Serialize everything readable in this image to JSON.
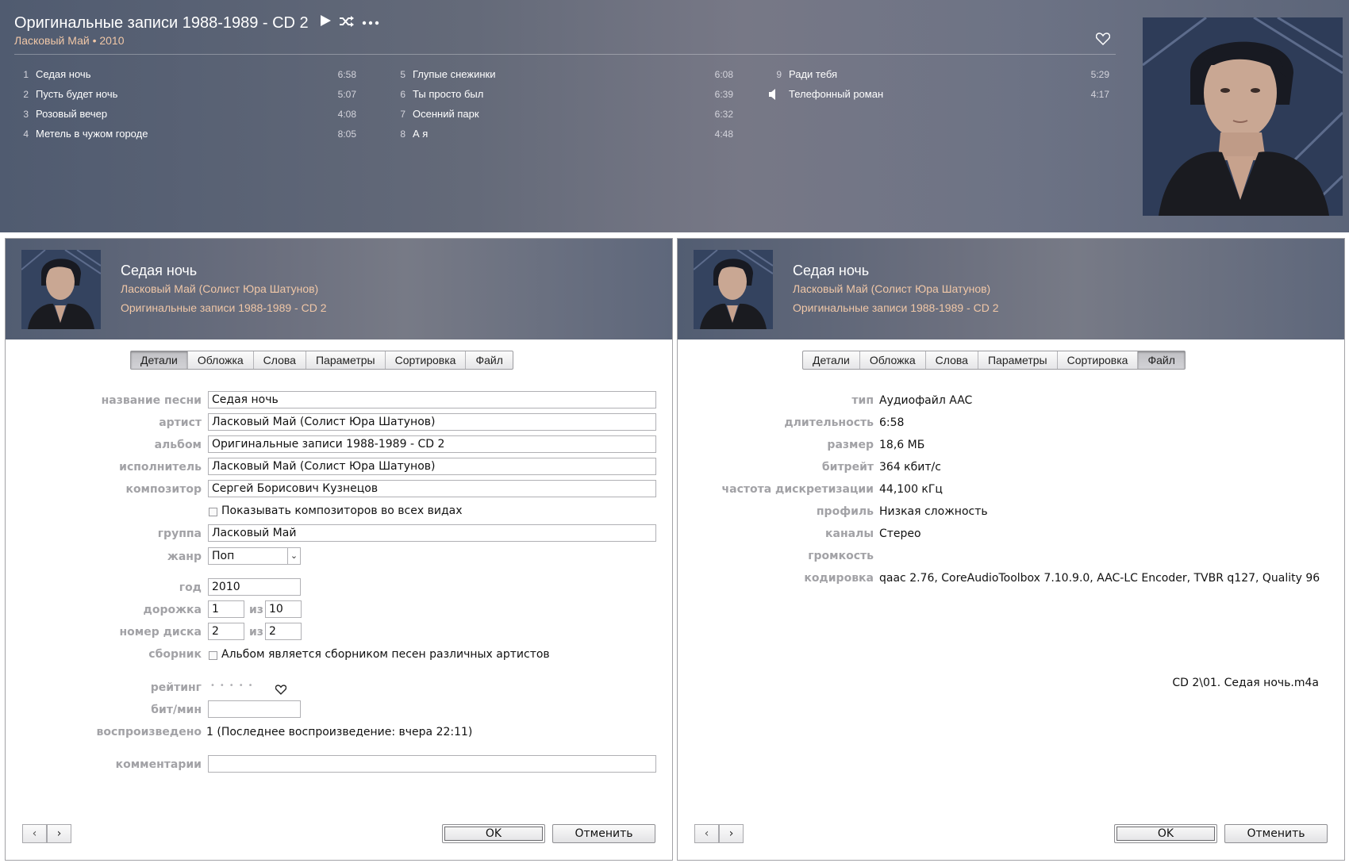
{
  "album": {
    "title": "Оригинальные записи 1988-1989 - CD 2",
    "subtitle": "Ласковый Май • 2010",
    "play_icon": "play-icon",
    "shuffle_icon": "shuffle-icon",
    "more_icon": "more-icon",
    "love_icon": "heart-icon"
  },
  "tracks": [
    {
      "num": "1",
      "name": "Седая ночь",
      "dur": "6:58"
    },
    {
      "num": "2",
      "name": "Пусть будет ночь",
      "dur": "5:07"
    },
    {
      "num": "3",
      "name": "Розовый вечер",
      "dur": "4:08"
    },
    {
      "num": "4",
      "name": "Метель в чужом городе",
      "dur": "8:05"
    },
    {
      "num": "5",
      "name": "Глупые снежинки",
      "dur": "6:08"
    },
    {
      "num": "6",
      "name": "Ты просто был",
      "dur": "6:39"
    },
    {
      "num": "7",
      "name": "Осенний парк",
      "dur": "6:32"
    },
    {
      "num": "8",
      "name": "А я",
      "dur": "4:48"
    },
    {
      "num": "9",
      "name": "Ради тебя",
      "dur": "5:29"
    },
    {
      "num": "",
      "name": "Телефонный роман",
      "dur": "4:17",
      "playing": true
    }
  ],
  "dialog": {
    "title": "Седая ночь",
    "artist": "Ласковый Май (Солист Юра Шатунов)",
    "album": "Оригинальные записи 1988-1989 - CD 2",
    "tabs": [
      "Детали",
      "Обложка",
      "Слова",
      "Параметры",
      "Сортировка",
      "Файл"
    ],
    "ok": "OK",
    "cancel": "Отменить",
    "prev_icon": "chevron-left-icon",
    "next_icon": "chevron-right-icon"
  },
  "details": {
    "labels": {
      "song_name": "название песни",
      "artist": "артист",
      "album": "альбом",
      "album_artist": "исполнитель",
      "composer": "композитор",
      "grouping": "группа",
      "genre": "жанр",
      "year": "год",
      "track": "дорожка",
      "disc": "номер диска",
      "compilation": "сборник",
      "rating": "рейтинг",
      "bpm": "бит/мин",
      "plays": "воспроизведено",
      "comments": "комментарии",
      "of": "из"
    },
    "song_name": "Седая ночь",
    "artist": "Ласковый Май (Солист Юра Шатунов)",
    "album": "Оригинальные записи 1988-1989 - CD 2",
    "album_artist": "Ласковый Май (Солист Юра Шатунов)",
    "composer": "Сергей Борисович Кузнецов",
    "show_composer": "Показывать композиторов во всех видах",
    "grouping": "Ласковый Май",
    "genre": "Поп",
    "year": "2010",
    "track_num": "1",
    "track_total": "10",
    "disc_num": "2",
    "disc_total": "2",
    "compilation_text": "Альбом является сборником песен различных артистов",
    "rating_stars": 0,
    "bpm": "",
    "plays": "1 (Последнее воспроизведение: вчера 22:11)",
    "comments": ""
  },
  "file": {
    "labels": {
      "kind": "тип",
      "duration": "длительность",
      "size": "размер",
      "bitrate": "битрейт",
      "sample_rate": "частота дискретизации",
      "profile": "профиль",
      "channels": "каналы",
      "volume": "громкость",
      "encoded": "кодировка"
    },
    "kind": "Аудиофайл AAC",
    "duration": "6:58",
    "size": "18,6 МБ",
    "bitrate": "364 кбит/с",
    "sample_rate": "44,100 кГц",
    "profile": "Низкая сложность",
    "channels": "Стерео",
    "volume": "",
    "encoded": "qaac 2.76, CoreAudioToolbox 7.10.9.0, AAC-LC Encoder, TVBR q127, Quality 96",
    "path": "CD 2\\01. Седая ночь.m4a"
  }
}
